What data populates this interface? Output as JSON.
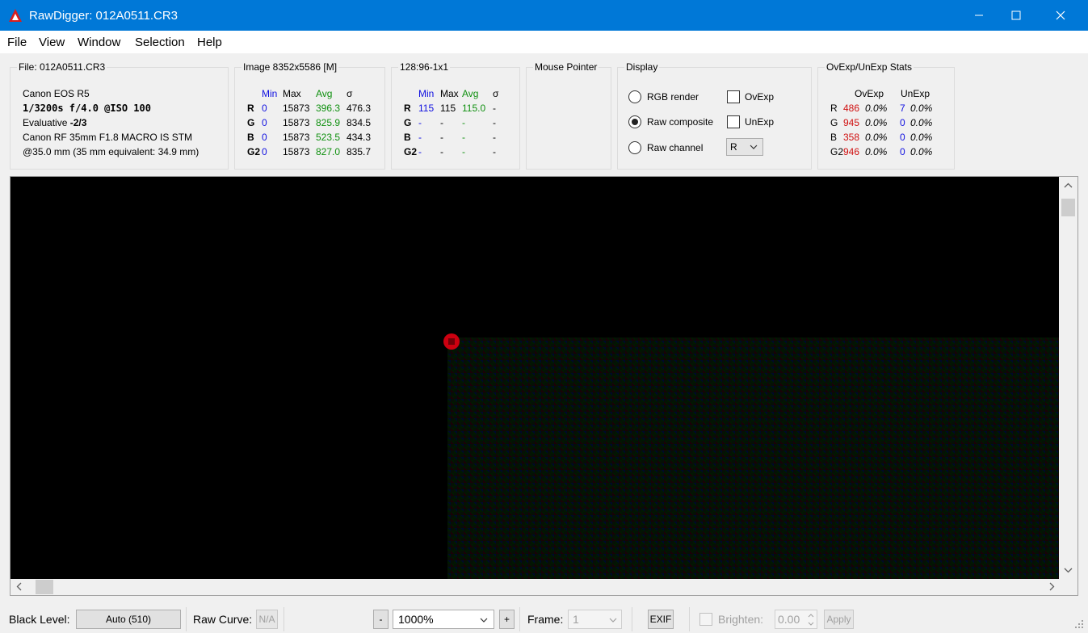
{
  "window": {
    "title": "RawDigger: 012A0511.CR3"
  },
  "menu": {
    "file": "File",
    "view": "View",
    "window": "Window",
    "selection": "Selection",
    "help": "Help"
  },
  "file_panel": {
    "title": "File: 012A0511.CR3",
    "camera": "Canon EOS R5",
    "exposure": "1/3200s f/4.0 @ISO 100",
    "metering_label": "Evaluative ",
    "metering_value": "-2/3",
    "lens": "Canon RF 35mm F1.8 MACRO IS STM",
    "focal": "@35.0 mm (35 mm equivalent: 34.9 mm)"
  },
  "image_panel": {
    "title": "Image 8352x5586 [M]",
    "headers": {
      "min": "Min",
      "max": "Max",
      "avg": "Avg",
      "sigma": "σ"
    },
    "rows": [
      {
        "ch": "R",
        "min": "0",
        "max": "15873",
        "avg": "396.3",
        "sigma": "476.3"
      },
      {
        "ch": "G",
        "min": "0",
        "max": "15873",
        "avg": "825.9",
        "sigma": "834.5"
      },
      {
        "ch": "B",
        "min": "0",
        "max": "15873",
        "avg": "523.5",
        "sigma": "434.3"
      },
      {
        "ch": "G2",
        "min": "0",
        "max": "15873",
        "avg": "827.0",
        "sigma": "835.7"
      }
    ]
  },
  "sample_panel": {
    "title": "128:96-1x1",
    "headers": {
      "min": "Min",
      "max": "Max",
      "avg": "Avg",
      "sigma": "σ"
    },
    "rows": [
      {
        "ch": "R",
        "min": "115",
        "max": "115",
        "avg": "115.0",
        "sigma": "-"
      },
      {
        "ch": "G",
        "min": "-",
        "max": "-",
        "avg": "-",
        "sigma": "-"
      },
      {
        "ch": "B",
        "min": "-",
        "max": "-",
        "avg": "-",
        "sigma": "-"
      },
      {
        "ch": "G2",
        "min": "-",
        "max": "-",
        "avg": "-",
        "sigma": "-"
      }
    ]
  },
  "mouse_panel": {
    "title": "Mouse Pointer"
  },
  "display_panel": {
    "title": "Display",
    "rgb_render": "RGB render",
    "raw_composite": "Raw composite",
    "raw_channel": "Raw channel",
    "ovexp": "OvExp",
    "unexp": "UnExp",
    "channel_value": "R",
    "selected": "raw_composite"
  },
  "stats_panel": {
    "title": "OvExp/UnExp Stats",
    "headers": {
      "ovexp": "OvExp",
      "unexp": "UnExp"
    },
    "rows": [
      {
        "ch": "R",
        "ov": "486",
        "ov_pct": "0.0%",
        "un": "7",
        "un_pct": "0.0%"
      },
      {
        "ch": "G",
        "ov": "945",
        "ov_pct": "0.0%",
        "un": "0",
        "un_pct": "0.0%"
      },
      {
        "ch": "B",
        "ov": "358",
        "ov_pct": "0.0%",
        "un": "0",
        "un_pct": "0.0%"
      },
      {
        "ch": "G2",
        "ov": "946",
        "ov_pct": "0.0%",
        "un": "0",
        "un_pct": "0.0%"
      }
    ]
  },
  "toolbar": {
    "black_level_label": "Black Level:",
    "black_level_value": "Auto (510)",
    "raw_curve_label": "Raw Curve:",
    "raw_curve_value": "N/A",
    "zoom_minus": "-",
    "zoom_value": "1000%",
    "zoom_plus": "+",
    "frame_label": "Frame:",
    "frame_value": "1",
    "exif": "EXIF",
    "brighten_label": "Brighten:",
    "brighten_value": "0.00",
    "apply": "Apply"
  },
  "colors": {
    "titlebar": "#0078d7",
    "min_color": "#1010e0",
    "avg_color": "#109010",
    "over_color": "#d01010",
    "marker": "#cc0010"
  }
}
